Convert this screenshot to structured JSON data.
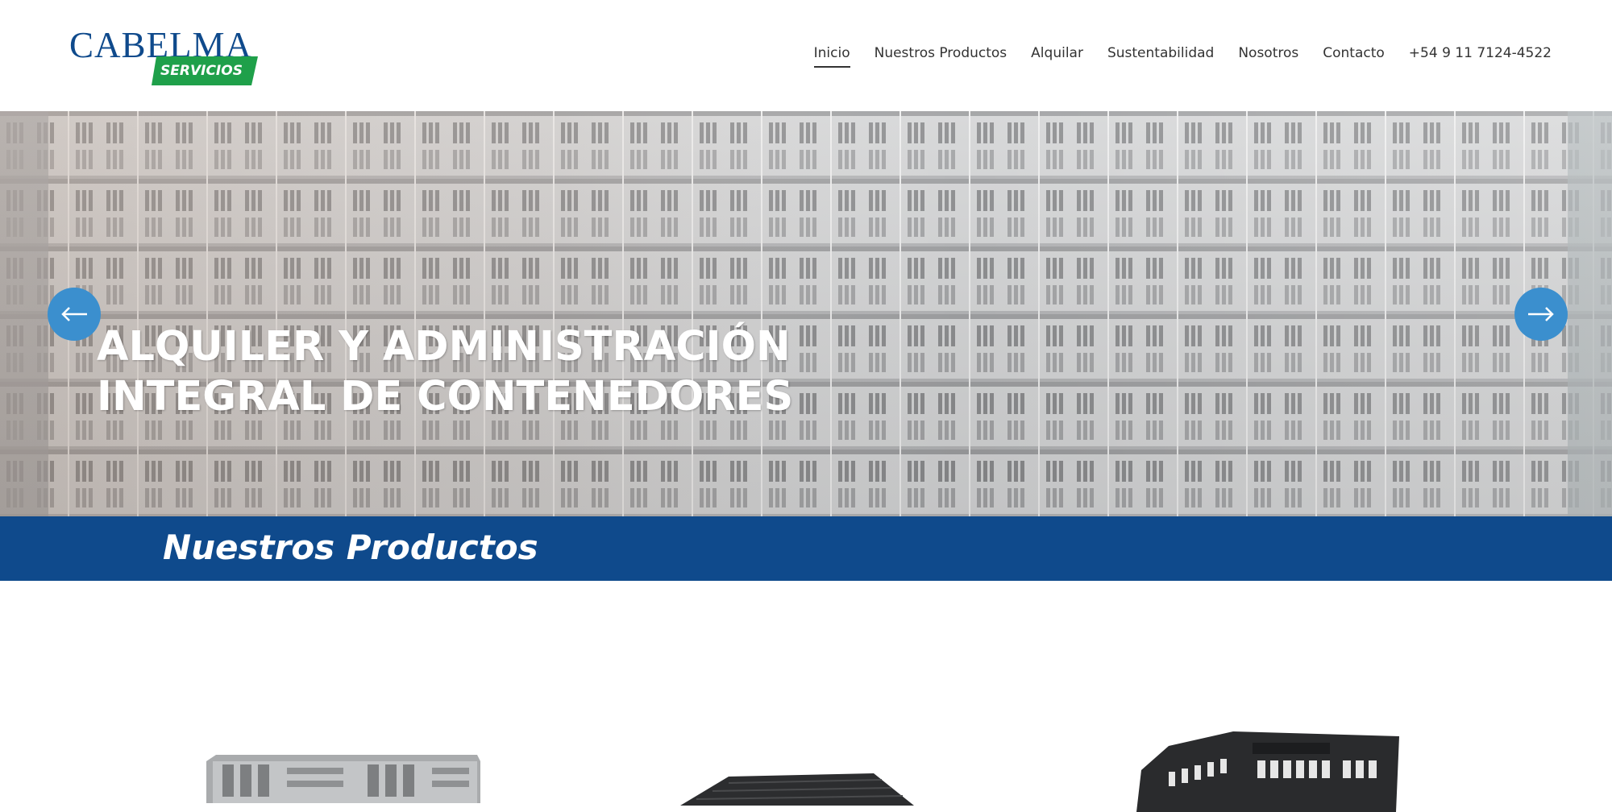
{
  "header": {
    "logo": {
      "name": "CABELMA",
      "tagline": "SERVICIOS"
    },
    "nav": [
      {
        "label": "Inicio",
        "active": true
      },
      {
        "label": "Nuestros Productos",
        "active": false
      },
      {
        "label": "Alquilar",
        "active": false
      },
      {
        "label": "Sustentabilidad",
        "active": false
      },
      {
        "label": "Nosotros",
        "active": false
      },
      {
        "label": "Contacto",
        "active": false
      },
      {
        "label": "+54 9 11 7124-4522",
        "active": false
      }
    ]
  },
  "hero": {
    "title_line1": "ALQUILER Y ADMINISTRACIÓN",
    "title_line2": "INTEGRAL DE CONTENEDORES",
    "prev_icon": "arrow-left-icon",
    "next_icon": "arrow-right-icon"
  },
  "products_section": {
    "title": "Nuestros Productos"
  },
  "colors": {
    "brand_blue": "#0f4a8c",
    "brand_green": "#1fa04a",
    "arrow_blue": "#3b8fce"
  }
}
